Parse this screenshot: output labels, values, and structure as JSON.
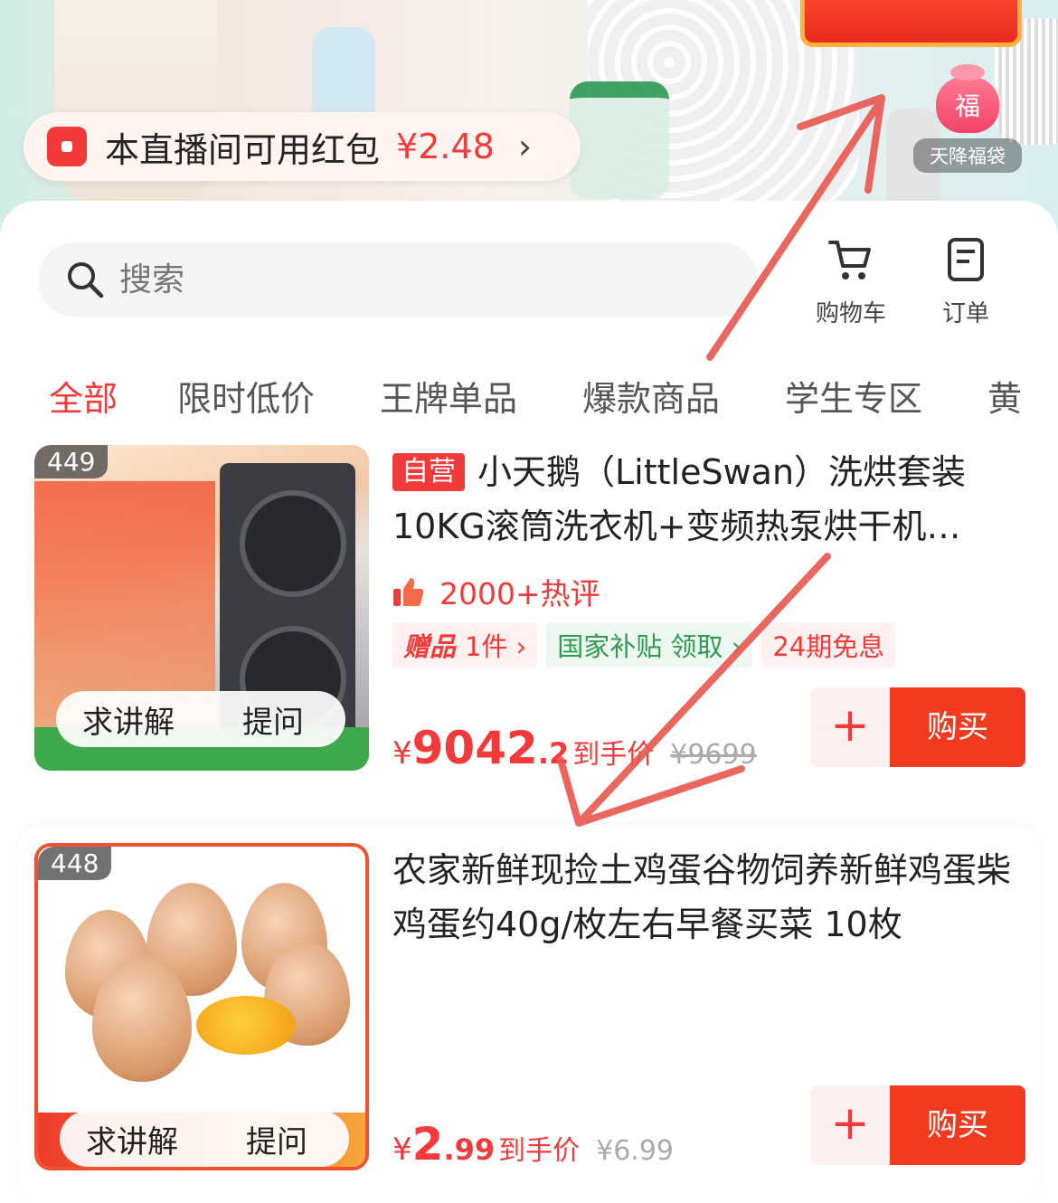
{
  "stream": {
    "red_packet": {
      "text": "本直播间可用红包",
      "amount": "¥2.48",
      "arrow": "›"
    },
    "fudai": {
      "glyph": "福",
      "label": "天降福袋"
    }
  },
  "header": {
    "search_placeholder": "搜索",
    "cart_label": "购物车",
    "order_label": "订单"
  },
  "tabs": [
    "全部",
    "限时低价",
    "王牌单品",
    "爆款商品",
    "学生专区",
    "黄"
  ],
  "products": [
    {
      "rank": "449",
      "tag": "自营",
      "title": "小天鹅（LittleSwan）洗烘套装10KG滚筒洗衣机+变频热泵烘干机…",
      "hot": "2000+热评",
      "gift_label": "赠品",
      "gift_count": "1件 ›",
      "subsidy": "国家补贴  领取 ›",
      "installment": "24期免息",
      "explain": "求讲解",
      "ask": "提问",
      "price_symbol": "¥",
      "price_int": "9042",
      "price_dec": ".2",
      "price_label": "到手价",
      "price_orig": "¥9699",
      "add": "+",
      "buy": "购买"
    },
    {
      "rank": "448",
      "title": "农家新鲜现捡土鸡蛋谷物饲养新鲜鸡蛋柴鸡蛋约40g/枚左右早餐买菜 10枚",
      "explain": "求讲解",
      "ask": "提问",
      "price_symbol": "¥",
      "price_int": "2",
      "price_dec": ".99",
      "price_label": "到手价",
      "price_orig": "¥6.99",
      "add": "+",
      "buy": "购买"
    }
  ],
  "colors": {
    "accent": "#f23a3a",
    "green": "#2f9a53",
    "annotation": "#e8564f"
  }
}
